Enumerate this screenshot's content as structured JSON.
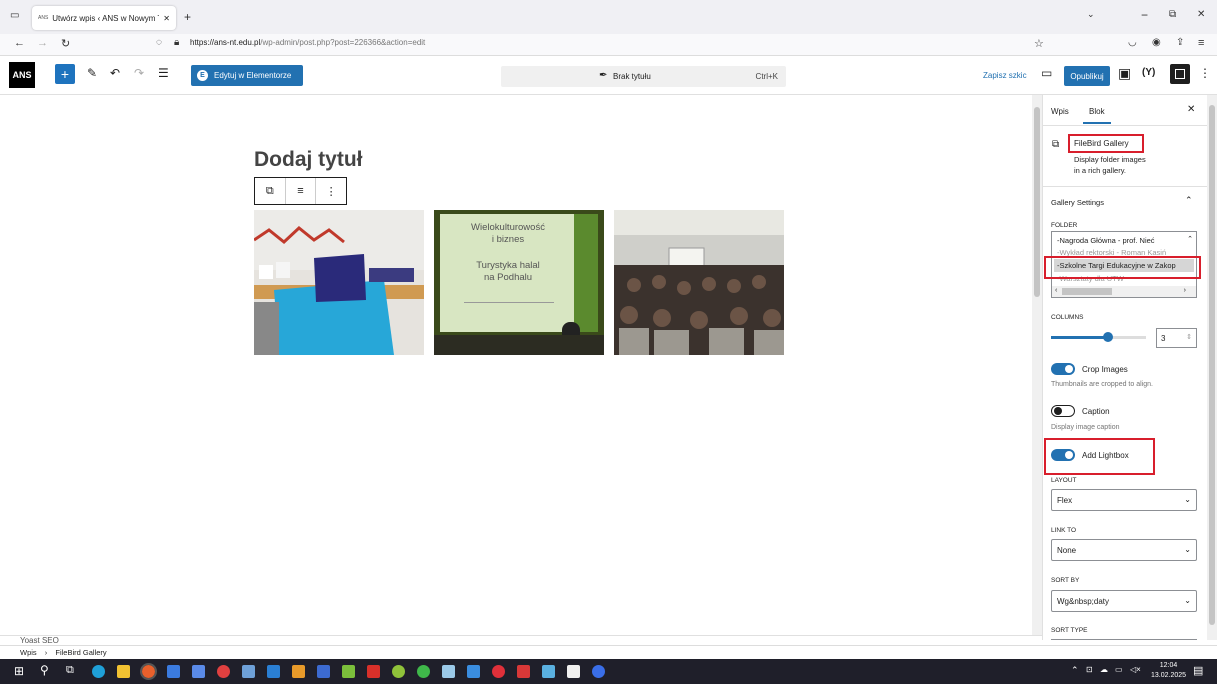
{
  "browser": {
    "tab_title": "Utwórz wpis ‹ ANS w Nowym T",
    "tab_favicon": "ANS",
    "url_domain": "https://ans-nt.edu.pl",
    "url_path": "/wp-admin/post.php?post=226366&action=edit"
  },
  "toolbar": {
    "logo": "ANS",
    "elementor_label": "Edytuj w Elementorze",
    "command_title": "Brak tytułu",
    "command_shortcut": "Ctrl+K",
    "save_draft": "Zapisz szkic",
    "publish": "Opublikuj"
  },
  "editor": {
    "title_placeholder": "Dodaj tytuł",
    "gallery": [
      {
        "alt": "Stoisko ANS z materiałami na targach"
      },
      {
        "alt": "Slajd: Wielokulturowość i biznes — Turystyka halal na Podhalu",
        "line1": "Wielokulturowość",
        "line2": "i biznes",
        "line3": "Turystyka halal",
        "line4": "na Podhalu"
      },
      {
        "alt": "Sala wykładowa z publicznością"
      }
    ]
  },
  "sidebar": {
    "tab_post": "Wpis",
    "tab_block": "Blok",
    "block_name": "FileBird Gallery",
    "block_desc1": "Display folder images",
    "block_desc2": "in a rich gallery.",
    "section_title": "Gallery Settings",
    "folder_label": "FOLDER",
    "folders": [
      "-Nagroda Główna - prof. Nieć",
      "-Wykład rektorski - Roman Kasiń",
      "-Szkolne Targi Edukacyjne w Zakop",
      "-Warsztaty dla UTW"
    ],
    "selected_folder": "-Szkolne Targi Edukacyjne w Zakop",
    "columns_label": "COLUMNS",
    "columns_value": "3",
    "columns_fraction": 0.6,
    "crop_label": "Crop Images",
    "crop_help": "Thumbnails are cropped to align.",
    "crop_on": true,
    "caption_label": "Caption",
    "caption_help": "Display image caption",
    "caption_on": false,
    "lightbox_label": "Add Lightbox",
    "lightbox_on": true,
    "layout_label": "LAYOUT",
    "layout_value": "Flex",
    "link_label": "LINK TO",
    "link_value": "None",
    "sort_by_label": "SORT BY",
    "sort_by_value": "Wg&nbsp;daty",
    "sort_type_label": "SORT TYPE"
  },
  "status": {
    "yoast": "Yoast SEO",
    "crumb_root": "Wpis",
    "crumb_sep": "›",
    "crumb_current": "FileBird Gallery"
  },
  "taskbar": {
    "time": "12:04",
    "date": "13.02.2025"
  },
  "colors": {
    "accent": "#2271b1",
    "highlight_red": "#d81e2c",
    "taskbar": "#1f1f2a"
  }
}
